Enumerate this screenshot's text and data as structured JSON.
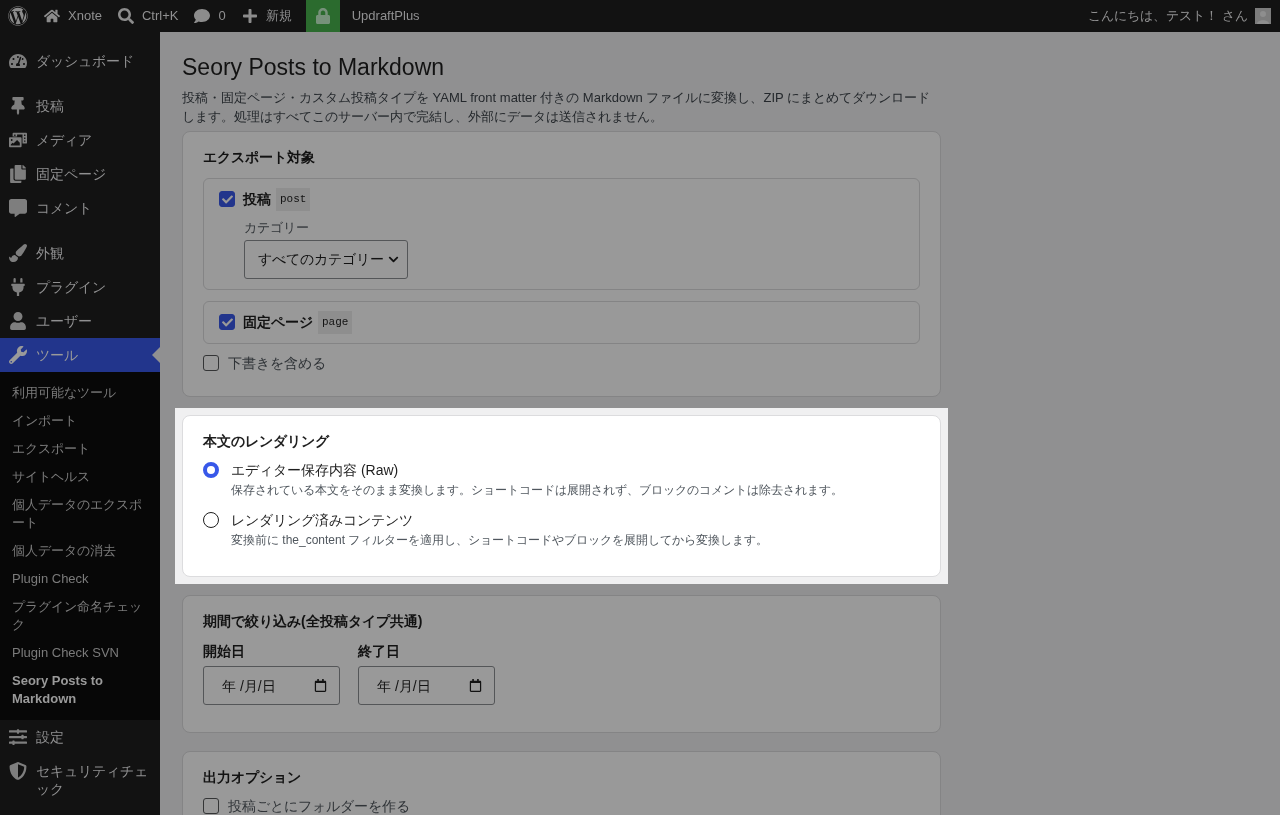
{
  "admin_bar": {
    "items": [
      {
        "kind": "logo"
      },
      {
        "kind": "home",
        "label": "Xnote"
      },
      {
        "kind": "search",
        "label": "Ctrl+K"
      },
      {
        "kind": "comments",
        "label": "0"
      },
      {
        "kind": "new",
        "label": "新規"
      },
      {
        "kind": "lock"
      },
      {
        "kind": "plain",
        "label": "UpdraftPlus"
      }
    ],
    "greeting": "こんにちは、テスト！ さん"
  },
  "sidebar": {
    "menu_groups": [
      {
        "items": [
          {
            "kind": "dashboard",
            "label": "ダッシュボード",
            "selected": false
          }
        ]
      },
      {
        "items": [
          {
            "kind": "posts",
            "label": "投稿",
            "selected": false
          },
          {
            "kind": "media",
            "label": "メディア",
            "selected": false
          },
          {
            "kind": "pages",
            "label": "固定ページ",
            "selected": false
          },
          {
            "kind": "comments",
            "label": "コメント",
            "selected": false
          }
        ]
      },
      {
        "items": [
          {
            "kind": "appearance",
            "label": "外観",
            "selected": false
          },
          {
            "kind": "plugins",
            "label": "プラグイン",
            "selected": false
          },
          {
            "kind": "users",
            "label": "ユーザー",
            "selected": false
          },
          {
            "kind": "tools",
            "label": "ツール",
            "selected": true,
            "children": [
              {
                "label": "利用可能なツール",
                "selected": false
              },
              {
                "label": "インポート",
                "selected": false
              },
              {
                "label": "エクスポート",
                "selected": false
              },
              {
                "label": "サイトヘルス",
                "selected": false
              },
              {
                "label": "個人データのエクスポート",
                "selected": false
              },
              {
                "label": "個人データの消去",
                "selected": false
              },
              {
                "label": "Plugin Check",
                "selected": false
              },
              {
                "label": "プラグイン命名チェック",
                "selected": false
              },
              {
                "label": "Plugin Check SVN",
                "selected": false
              },
              {
                "label": "Seory Posts to Markdown",
                "selected": true
              }
            ]
          },
          {
            "kind": "settings",
            "label": "設定",
            "selected": false
          },
          {
            "kind": "security",
            "label": "セキュリティチェック",
            "selected": false
          }
        ]
      }
    ]
  },
  "page": {
    "title": "Seory Posts to Markdown",
    "description": "投稿・固定ページ・カスタム投稿タイプを YAML front matter 付きの Markdown ファイルに変換し、ZIP にまとめてダウンロードします。処理はすべてこのサーバー内で完結し、外部にデータは送信されません。"
  },
  "sections": [
    {
      "kind": "export_targets",
      "title": "エクスポート対象",
      "highlighted": false,
      "post_types": [
        {
          "label": "投稿",
          "slug": "post",
          "checked": true,
          "category": {
            "label": "カテゴリー",
            "value": "すべてのカテゴリー"
          }
        },
        {
          "label": "固定ページ",
          "slug": "page",
          "checked": true
        }
      ],
      "options": [
        {
          "label": "下書きを含める",
          "checked": false
        }
      ]
    },
    {
      "kind": "rendering",
      "title": "本文のレンダリング",
      "highlighted": true,
      "choices": [
        {
          "label": "エディター保存内容 (Raw)",
          "description": "保存されている本文をそのまま変換します。ショートコードは展開されず、ブロックのコメントは除去されます。",
          "selected": true
        },
        {
          "label": "レンダリング済みコンテンツ",
          "description": "変換前に the_content フィルターを適用し、ショートコードやブロックを展開してから変換します。",
          "selected": false
        }
      ]
    },
    {
      "kind": "date_range",
      "title": "期間で絞り込み(全投稿タイプ共通)",
      "highlighted": false,
      "fields": [
        {
          "label": "開始日",
          "placeholder": "年 /月/日"
        },
        {
          "label": "終了日",
          "placeholder": "年 /月/日"
        }
      ]
    },
    {
      "kind": "output_options",
      "title": "出力オプション",
      "highlighted": false,
      "options": [
        {
          "label": "投稿ごとにフォルダーを作る",
          "checked": false
        }
      ]
    }
  ]
}
